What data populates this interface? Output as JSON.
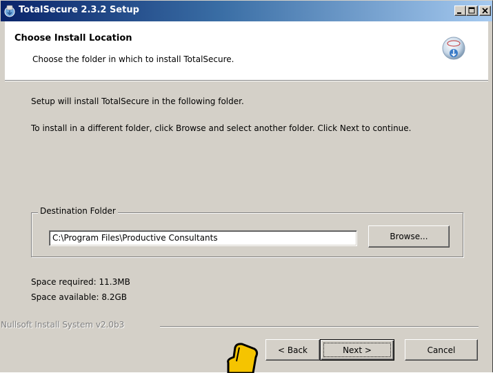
{
  "window": {
    "title": "TotalSecure 2.3.2 Setup"
  },
  "header": {
    "title": "Choose Install Location",
    "subtitle": "Choose the folder in which to install TotalSecure.",
    "icon": "installer-globe-icon"
  },
  "body": {
    "intro": "Setup will install TotalSecure in the following folder.",
    "instructions": "To install in a different folder, click Browse and select another folder. Click Next to continue."
  },
  "destination": {
    "group_label": "Destination Folder",
    "path": "C:\\Program Files\\Productive Consultants",
    "browse_label": "Browse..."
  },
  "space": {
    "required": "Space required: 11.3MB",
    "available": "Space available: 8.2GB"
  },
  "footer": {
    "branding": "Nullsoft Install System v2.0b3",
    "back_label": "< Back",
    "next_label": "Next >",
    "cancel_label": "Cancel"
  },
  "colors": {
    "titlebar_start": "#0a246a",
    "titlebar_end": "#a6caf0",
    "dialog_face": "#d4d0c8",
    "cursor_fill": "#f5c400"
  }
}
